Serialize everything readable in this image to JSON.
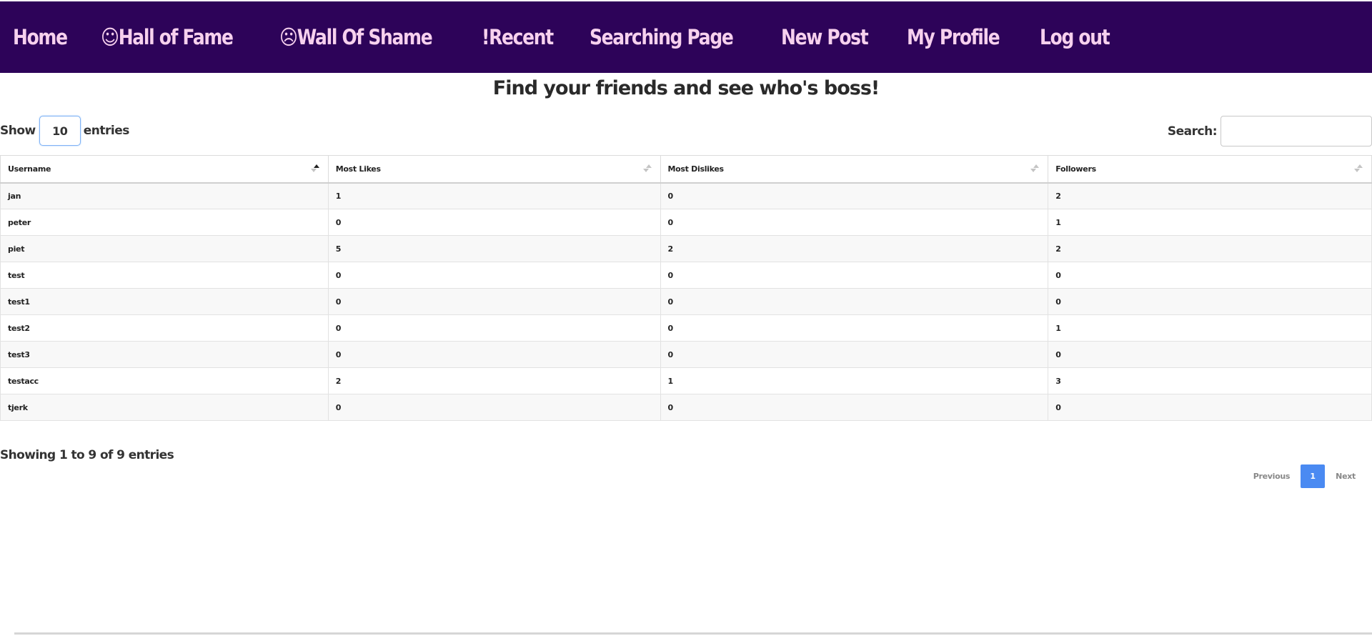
{
  "nav": {
    "items": [
      {
        "label": "Home"
      },
      {
        "label": "☺Hall of Fame"
      },
      {
        "label": "☹Wall Of Shame"
      },
      {
        "label": "!Recent"
      },
      {
        "label": "Searching Page"
      },
      {
        "label": "New Post"
      },
      {
        "label": "My Profile"
      },
      {
        "label": "Log out"
      }
    ]
  },
  "title": "Find your friends and see who's boss!",
  "length": {
    "prefix": "Show",
    "value": "10",
    "suffix": "entries"
  },
  "search": {
    "label": "Search:",
    "value": ""
  },
  "table": {
    "headers": [
      "Username",
      "Most Likes",
      "Most Dislikes",
      "Followers"
    ],
    "rows": [
      [
        "jan",
        "1",
        "0",
        "2"
      ],
      [
        "peter",
        "0",
        "0",
        "1"
      ],
      [
        "piet",
        "5",
        "2",
        "2"
      ],
      [
        "test",
        "0",
        "0",
        "0"
      ],
      [
        "test1",
        "0",
        "0",
        "0"
      ],
      [
        "test2",
        "0",
        "0",
        "1"
      ],
      [
        "test3",
        "0",
        "0",
        "0"
      ],
      [
        "testacc",
        "2",
        "1",
        "3"
      ],
      [
        "tjerk",
        "0",
        "0",
        "0"
      ]
    ]
  },
  "info": "Showing 1 to 9 of 9 entries",
  "pagination": {
    "previous": "Previous",
    "current": "1",
    "next": "Next"
  },
  "colors": {
    "nav_bg": "#2d0359",
    "nav_text": "#f7d1ee",
    "page_active": "#4a8af2"
  }
}
